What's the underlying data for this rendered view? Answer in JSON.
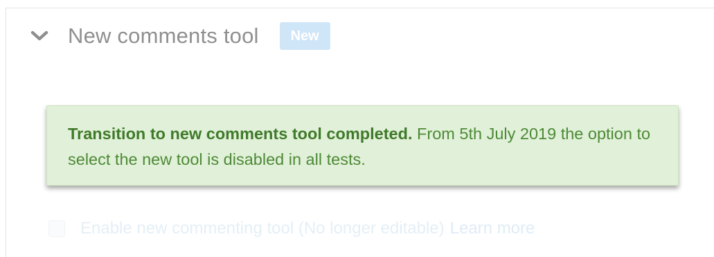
{
  "section": {
    "title": "New comments tool",
    "badge": "New",
    "chevron_icon": "chevron-down-icon"
  },
  "notice": {
    "heading": "Transition to new comments tool completed.",
    "body": "From 5th July 2019 the option to select the new tool is disabled in all tests."
  },
  "option": {
    "label": "Enable new commenting tool (No longer editable)",
    "link": "Learn more",
    "checked": false
  },
  "colors": {
    "notice_background": "#e1f0d8",
    "notice_text": "#4d8a37",
    "badge_background": "#cfe5f8"
  }
}
